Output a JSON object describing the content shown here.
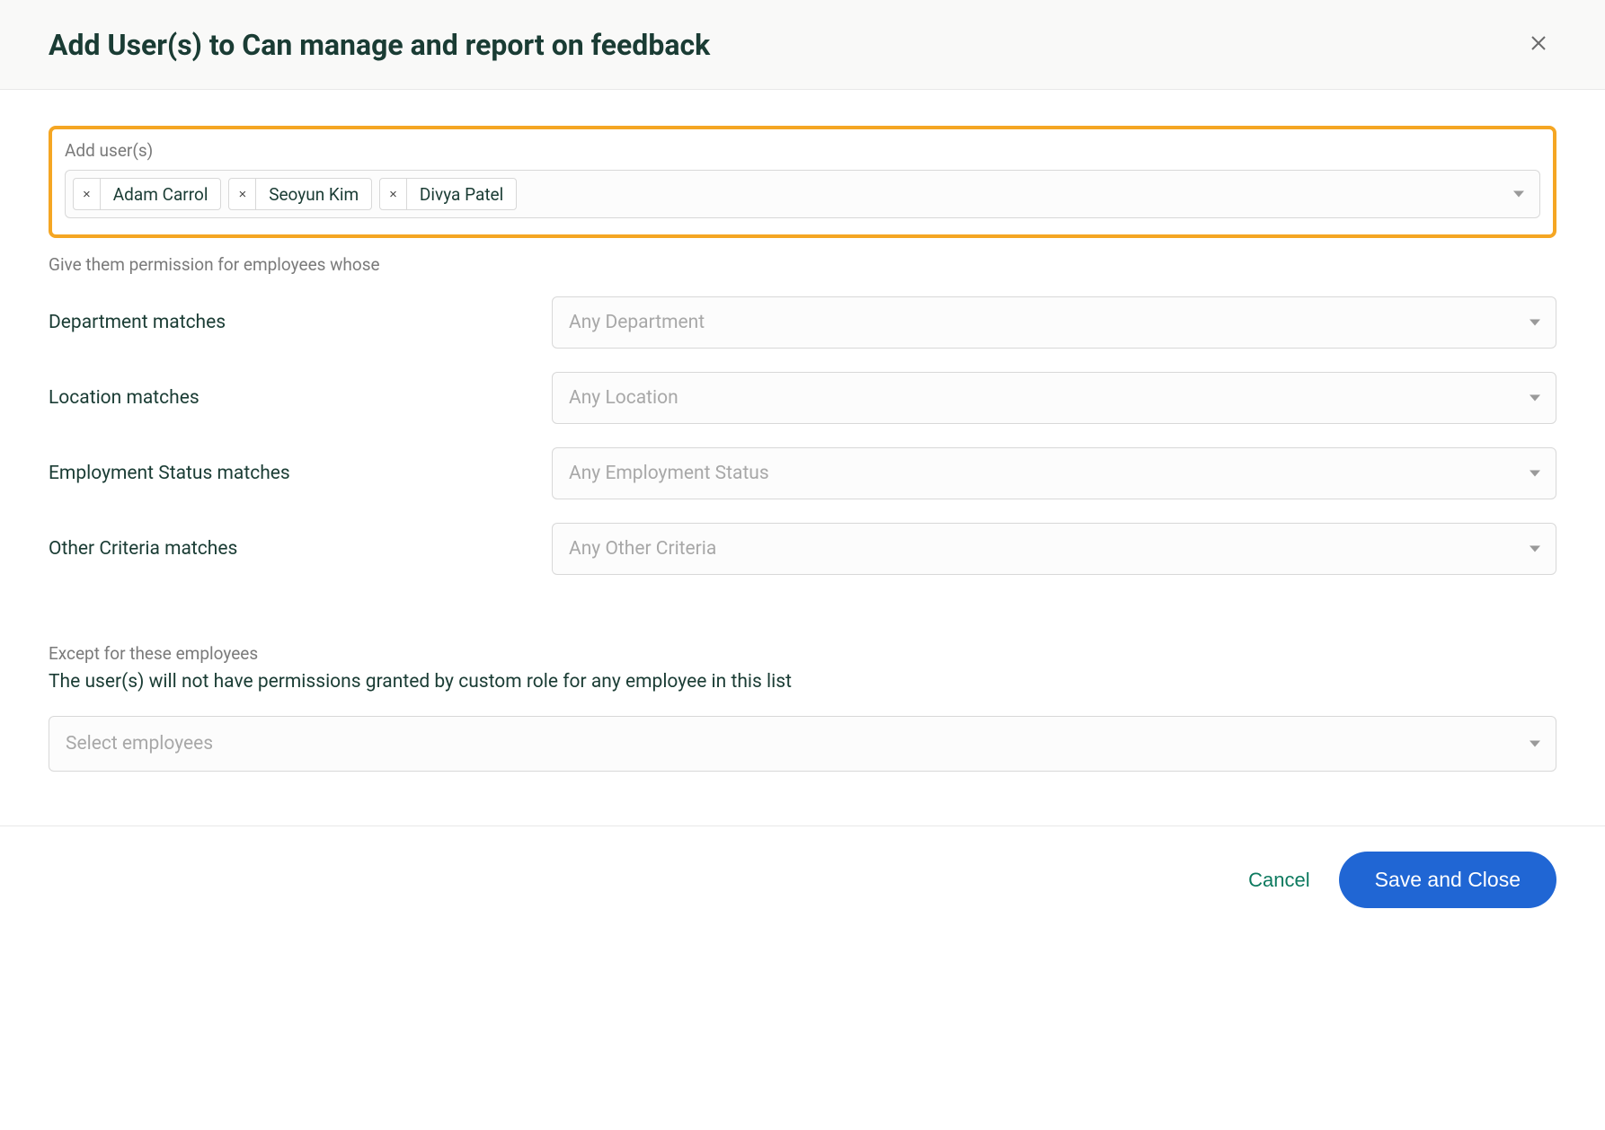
{
  "header": {
    "title": "Add User(s) to Can manage and report on feedback"
  },
  "users_field": {
    "label": "Add user(s)",
    "chips": [
      {
        "name": "Adam Carrol"
      },
      {
        "name": "Seoyun Kim"
      },
      {
        "name": "Divya Patel"
      }
    ]
  },
  "permission_intro": "Give them permission for employees whose",
  "criteria": [
    {
      "label": "Department matches",
      "placeholder": "Any Department"
    },
    {
      "label": "Location matches",
      "placeholder": "Any Location"
    },
    {
      "label": "Employment Status matches",
      "placeholder": "Any Employment Status"
    },
    {
      "label": "Other Criteria matches",
      "placeholder": "Any Other Criteria"
    }
  ],
  "exception": {
    "label": "Except for these employees",
    "description": "The user(s) will not have permissions granted by custom role for any employee in this list",
    "placeholder": "Select employees"
  },
  "footer": {
    "cancel": "Cancel",
    "save": "Save and Close"
  }
}
